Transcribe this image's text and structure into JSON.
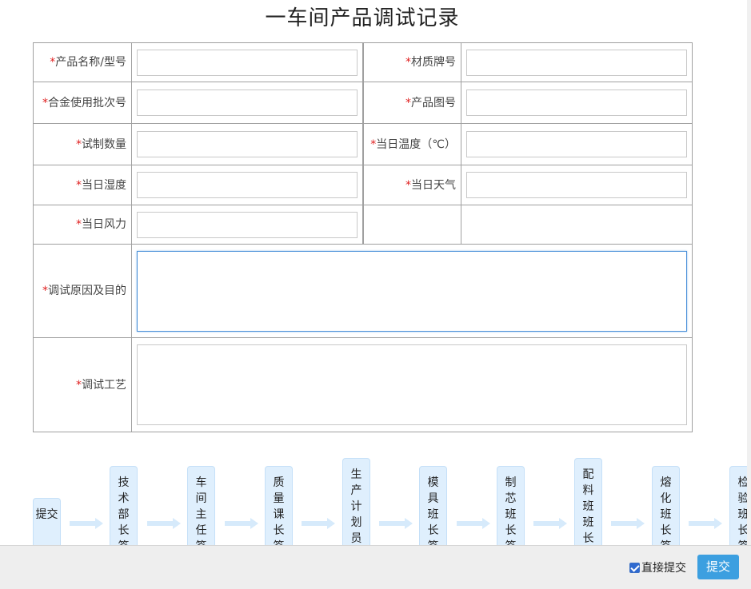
{
  "title": "一车间产品调试记录",
  "required_mark": "*",
  "form": {
    "product_name_label": "产品名称/型号",
    "material_label": "材质牌号",
    "alloy_batch_label": "合金使用批次号",
    "drawing_no_label": "产品图号",
    "trial_qty_label": "试制数量",
    "temp_label": "当日温度（℃）",
    "humidity_label": "当日湿度",
    "weather_label": "当日天气",
    "wind_label": "当日风力",
    "reason_label": "调试原因及目的",
    "process_label": "调试工艺"
  },
  "flow": {
    "nodes": [
      "提交",
      "技术部长签",
      "车间主任签",
      "质量课长签",
      "生产计划员",
      "模具班长签",
      "制芯班长签",
      "配料班班长",
      "熔化班长签",
      "检验班长签"
    ]
  },
  "footer": {
    "direct_submit_label": "直接提交",
    "direct_submit_checked": true,
    "submit_label": "提交"
  },
  "colors": {
    "accent": "#3c9fe0",
    "required": "#e02020",
    "flow_node_bg": "#dfeffd",
    "flow_arrow": "#d6eafb"
  }
}
